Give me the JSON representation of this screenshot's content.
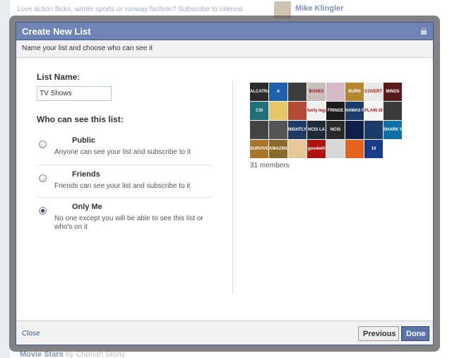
{
  "background": {
    "top_text": "Love action flicks, winter sports or runway fashion? Subscribe to interests featuring",
    "side_name": "Mike Klingler",
    "bottom_title": "Movie Stars",
    "bottom_sub": "by Chonah Stony"
  },
  "dialog": {
    "title": "Create New List",
    "subtitle": "Name your list and choose who can see it",
    "list_name_label": "List Name:",
    "list_name_value": "TV Shows",
    "who_label": "Who can see this list:",
    "options": [
      {
        "title": "Public",
        "desc": "Anyone can see your list and subscribe to it",
        "checked": false
      },
      {
        "title": "Friends",
        "desc": "Friends can see your list and subscribe to it",
        "checked": false
      },
      {
        "title": "Only Me",
        "desc": "No one except you will be able to see this list or who's on it",
        "checked": true
      }
    ],
    "members_count": "31 members",
    "thumbs": [
      {
        "label": "ALCATRAZ",
        "color": "#2b2b2b"
      },
      {
        "label": "A",
        "color": "#1d5fb0"
      },
      {
        "label": "",
        "color": "#3d3d3d"
      },
      {
        "label": "BONES",
        "color": "#c7c0bc"
      },
      {
        "label": "",
        "color": "#d6b9c4"
      },
      {
        "label": "BURN",
        "color": "#b8862f"
      },
      {
        "label": "COVERT AFFAIRS",
        "color": "#e9e9e9"
      },
      {
        "label": "MINDS",
        "color": "#5b1a1a"
      },
      {
        "label": "CSI",
        "color": "#1d6f7a"
      },
      {
        "label": "",
        "color": "#e5c76a"
      },
      {
        "label": "",
        "color": "#b24a3a"
      },
      {
        "label": "fairly legal",
        "color": "#f1f1f1"
      },
      {
        "label": "FRINGE",
        "color": "#1a1a1a"
      },
      {
        "label": "HAWAII FIVE-O",
        "color": "#1a3a6a"
      },
      {
        "label": "PLAIN SIGHT",
        "color": "#f5f5f5"
      },
      {
        "label": "",
        "color": "#3a3a3a"
      },
      {
        "label": "",
        "color": "#444444"
      },
      {
        "label": "",
        "color": "#555555"
      },
      {
        "label": "NIGHTLY NEWS",
        "color": "#203a66"
      },
      {
        "label": "NCIS LA",
        "color": "#1e2a3a"
      },
      {
        "label": "NCIS",
        "color": "#2a2a2a"
      },
      {
        "label": "",
        "color": "#0b1f4a"
      },
      {
        "label": "",
        "color": "#1b3b6b"
      },
      {
        "label": "SHARK WEEK",
        "color": "#0b6fa8"
      },
      {
        "label": "SURVIVOR",
        "color": "#a8762b"
      },
      {
        "label": "AMAZING RACE",
        "color": "#8a6a2a"
      },
      {
        "label": "",
        "color": "#e6c79a"
      },
      {
        "label": "goodwill",
        "color": "#b01212"
      },
      {
        "label": "",
        "color": "#d9d9d9"
      },
      {
        "label": "",
        "color": "#e5631f"
      },
      {
        "label": "10",
        "color": "#1a3b8a"
      }
    ],
    "close_label": "Close",
    "previous_label": "Previous",
    "done_label": "Done"
  }
}
